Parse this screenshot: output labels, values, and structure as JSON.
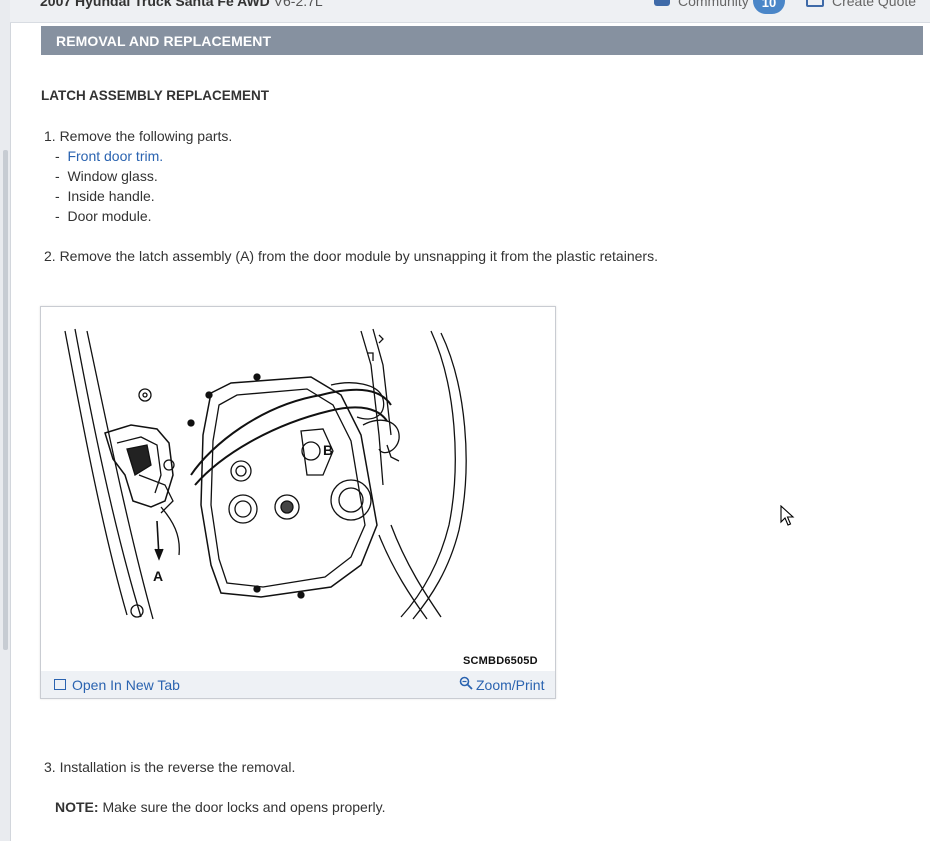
{
  "topbar": {
    "vehicle": "2007 Hyundai Truck Santa Fe AWD",
    "engine": "V6-2.7L",
    "community_label": "Community",
    "community_count": "10",
    "create_quote_label": "Create Quote"
  },
  "section": {
    "title": "REMOVAL AND REPLACEMENT"
  },
  "article": {
    "heading": "LATCH ASSEMBLY REPLACEMENT",
    "step1": "1. Remove the following parts.",
    "parts": [
      {
        "dash": "-",
        "label": "Front door trim.",
        "link": true
      },
      {
        "dash": "-",
        "label": "Window glass.",
        "link": false
      },
      {
        "dash": "-",
        "label": "Inside handle.",
        "link": false
      },
      {
        "dash": "-",
        "label": "Door module.",
        "link": false
      }
    ],
    "step2": "2. Remove the latch assembly (A) from the door module by unsnapping it from the plastic retainers.",
    "step3": "3. Installation is the reverse the removal.",
    "note_label": "NOTE:",
    "note_text": "Make sure the door locks and opens properly."
  },
  "figure": {
    "label_a": "A",
    "label_b": "B",
    "code": "SCMBD6505D",
    "open_tab_label": "Open In New Tab",
    "zoom_label": "Zoom/Print"
  },
  "icons": {
    "community": "chat-icon",
    "quote": "quote-icon",
    "open_tab": "open-tab-icon",
    "zoom": "magnifier-icon",
    "cursor": "mouse-cursor-icon"
  },
  "colors": {
    "section_header_bg": "#8691a0",
    "link": "#2a63b0",
    "badge": "#4a86c8"
  }
}
